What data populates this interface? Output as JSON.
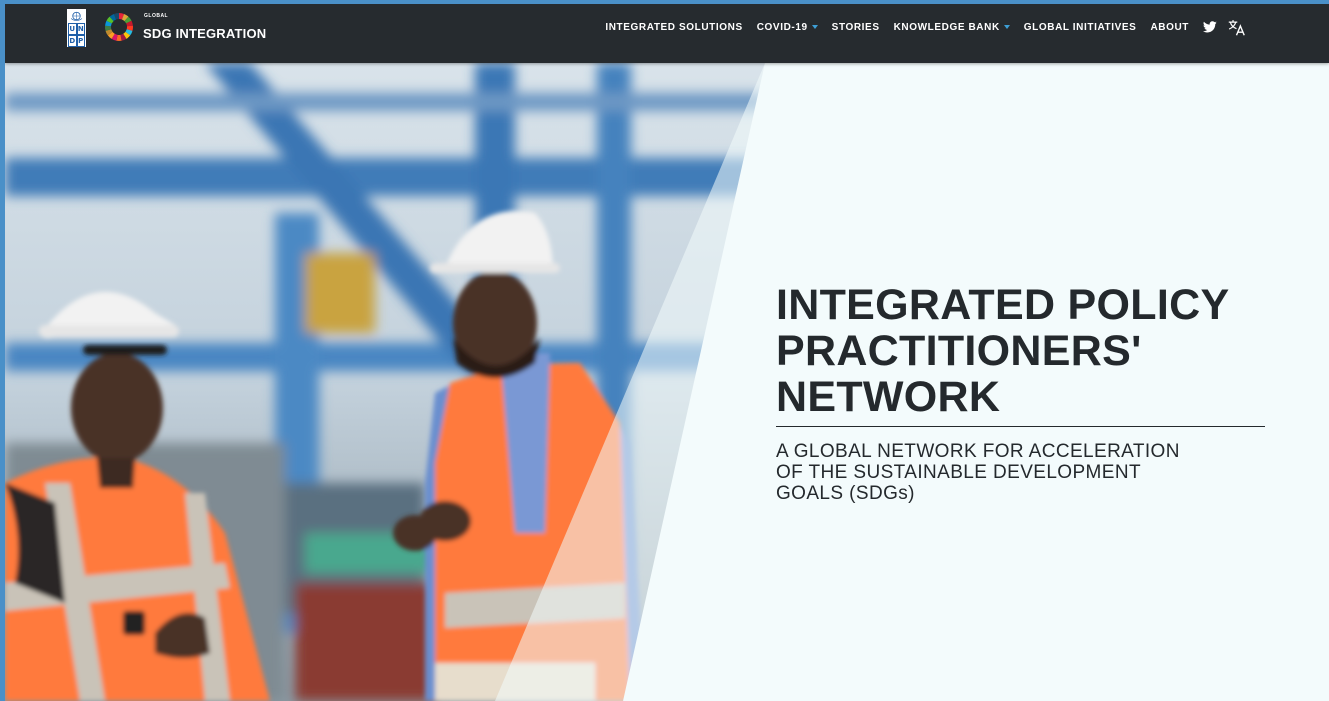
{
  "nav": {
    "brand_small": "GLOBAL",
    "brand_main": "SDG INTEGRATION",
    "undp_letters": [
      "U",
      "N",
      "D",
      "P"
    ],
    "items": [
      {
        "label": "INTEGRATED SOLUTIONS",
        "dropdown": false
      },
      {
        "label": "COVID-19",
        "dropdown": true
      },
      {
        "label": "STORIES",
        "dropdown": false
      },
      {
        "label": "KNOWLEDGE BANK",
        "dropdown": true
      },
      {
        "label": "GLOBAL INITIATIVES",
        "dropdown": false
      },
      {
        "label": "ABOUT",
        "dropdown": false
      }
    ],
    "icons": [
      "twitter-icon",
      "translate-icon"
    ],
    "colors": {
      "background": "#262b2f",
      "accent": "#3d9fd6"
    }
  },
  "hero": {
    "title": "INTEGRATED POLICY PRACTITIONERS' NETWORK",
    "subtitle": "A GLOBAL NETWORK FOR ACCELERATION OF THE SUSTAINABLE DEVELOPMENT GOALS (SDGs)",
    "image": "two-port-workers-in-hard-hats-and-safety-vests",
    "colors": {
      "panel": "#f3fbfc",
      "text": "#24292d"
    }
  }
}
